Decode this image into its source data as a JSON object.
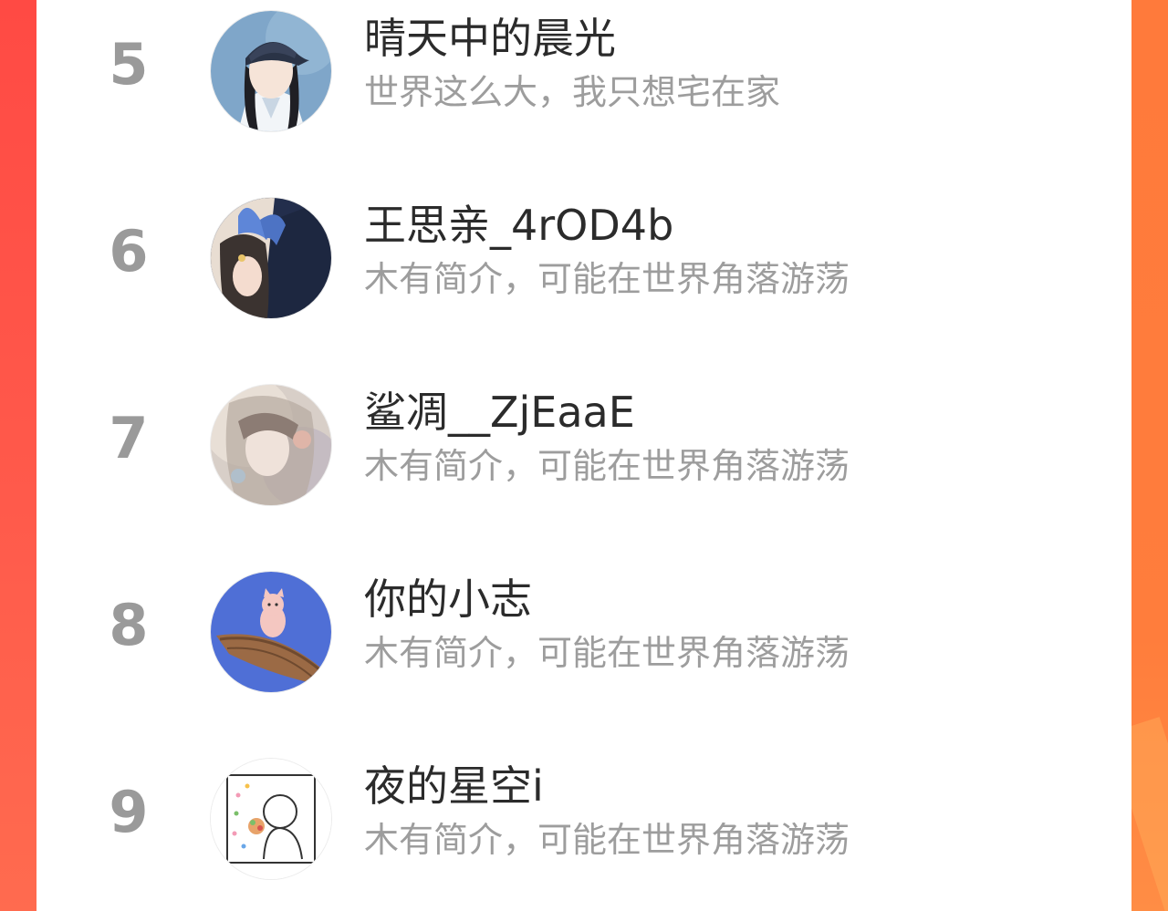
{
  "ranking_list": {
    "items": [
      {
        "rank": "5",
        "name": "晴天中的晨光",
        "bio": "世界这么大，我只想宅在家",
        "avatar_icon": "girl-with-cap-avatar"
      },
      {
        "rank": "6",
        "name": "王思亲_4rOD4b",
        "bio": "木有简介，可能在世界角落游荡",
        "avatar_icon": "girl-with-bunny-ears-avatar"
      },
      {
        "rank": "7",
        "name": "鲨凋__ZjEaaE",
        "bio": "木有简介，可能在世界角落游荡",
        "avatar_icon": "anime-girl-avatar"
      },
      {
        "rank": "8",
        "name": "你的小志",
        "bio": "木有简介，可能在世界角落游荡",
        "avatar_icon": "cat-on-boat-avatar"
      },
      {
        "rank": "9",
        "name": "夜的星空i",
        "bio": "木有简介，可能在世界角落游荡",
        "avatar_icon": "doodle-eating-avatar"
      }
    ]
  },
  "colors": {
    "accent_left": "#ff4a44",
    "accent_right": "#ff7a3b",
    "rank_text": "#9a9a9a",
    "name_text": "#2b2b2b",
    "bio_text": "#9d9d9d"
  }
}
